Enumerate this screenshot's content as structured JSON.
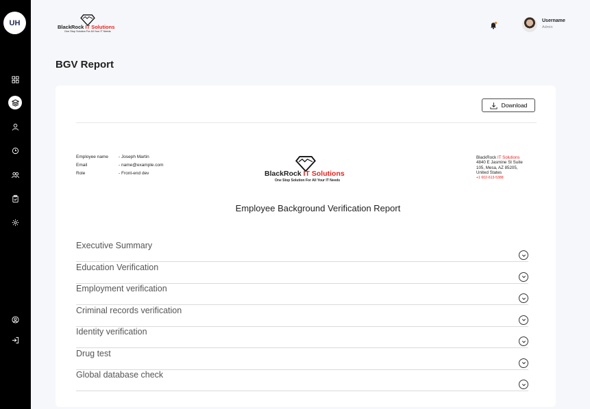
{
  "sidebar": {
    "logo_text": "UH"
  },
  "header": {
    "brand_name_black": "BlackRock",
    "brand_name_red": "IT Solutions",
    "brand_tagline": "One Stop Solution For All Your IT Needs",
    "username": "Username",
    "role": "Admin"
  },
  "page": {
    "title": "BGV Report"
  },
  "report": {
    "download_label": "Download",
    "employee": [
      {
        "label": "Employee name",
        "value": "-  Joseph Martin"
      },
      {
        "label": "Email",
        "value": "-  name@example.com"
      },
      {
        "label": "Role",
        "value": "-  Front-end dev"
      }
    ],
    "company": {
      "name_black": "BlackRock",
      "name_red": "IT Solutions",
      "tagline": "One Stop Solution For All Your IT Needs",
      "address_line1": "4840 E Jasmine St Suite",
      "address_line2": "105, Mesa, AZ 85205,",
      "address_line3": "United States",
      "phone": "+1 602-613-5388"
    },
    "title": "Employee Background Verification Report",
    "sections": [
      "Executive Summary",
      "Education Verification",
      "Employment verification",
      "Criminal records verification",
      "Identity verification",
      "Drug test",
      "Global database check"
    ]
  },
  "colors": {
    "accent_red": "#e52420",
    "sidebar_bg": "#000000",
    "page_bg": "#f6f7fa"
  }
}
